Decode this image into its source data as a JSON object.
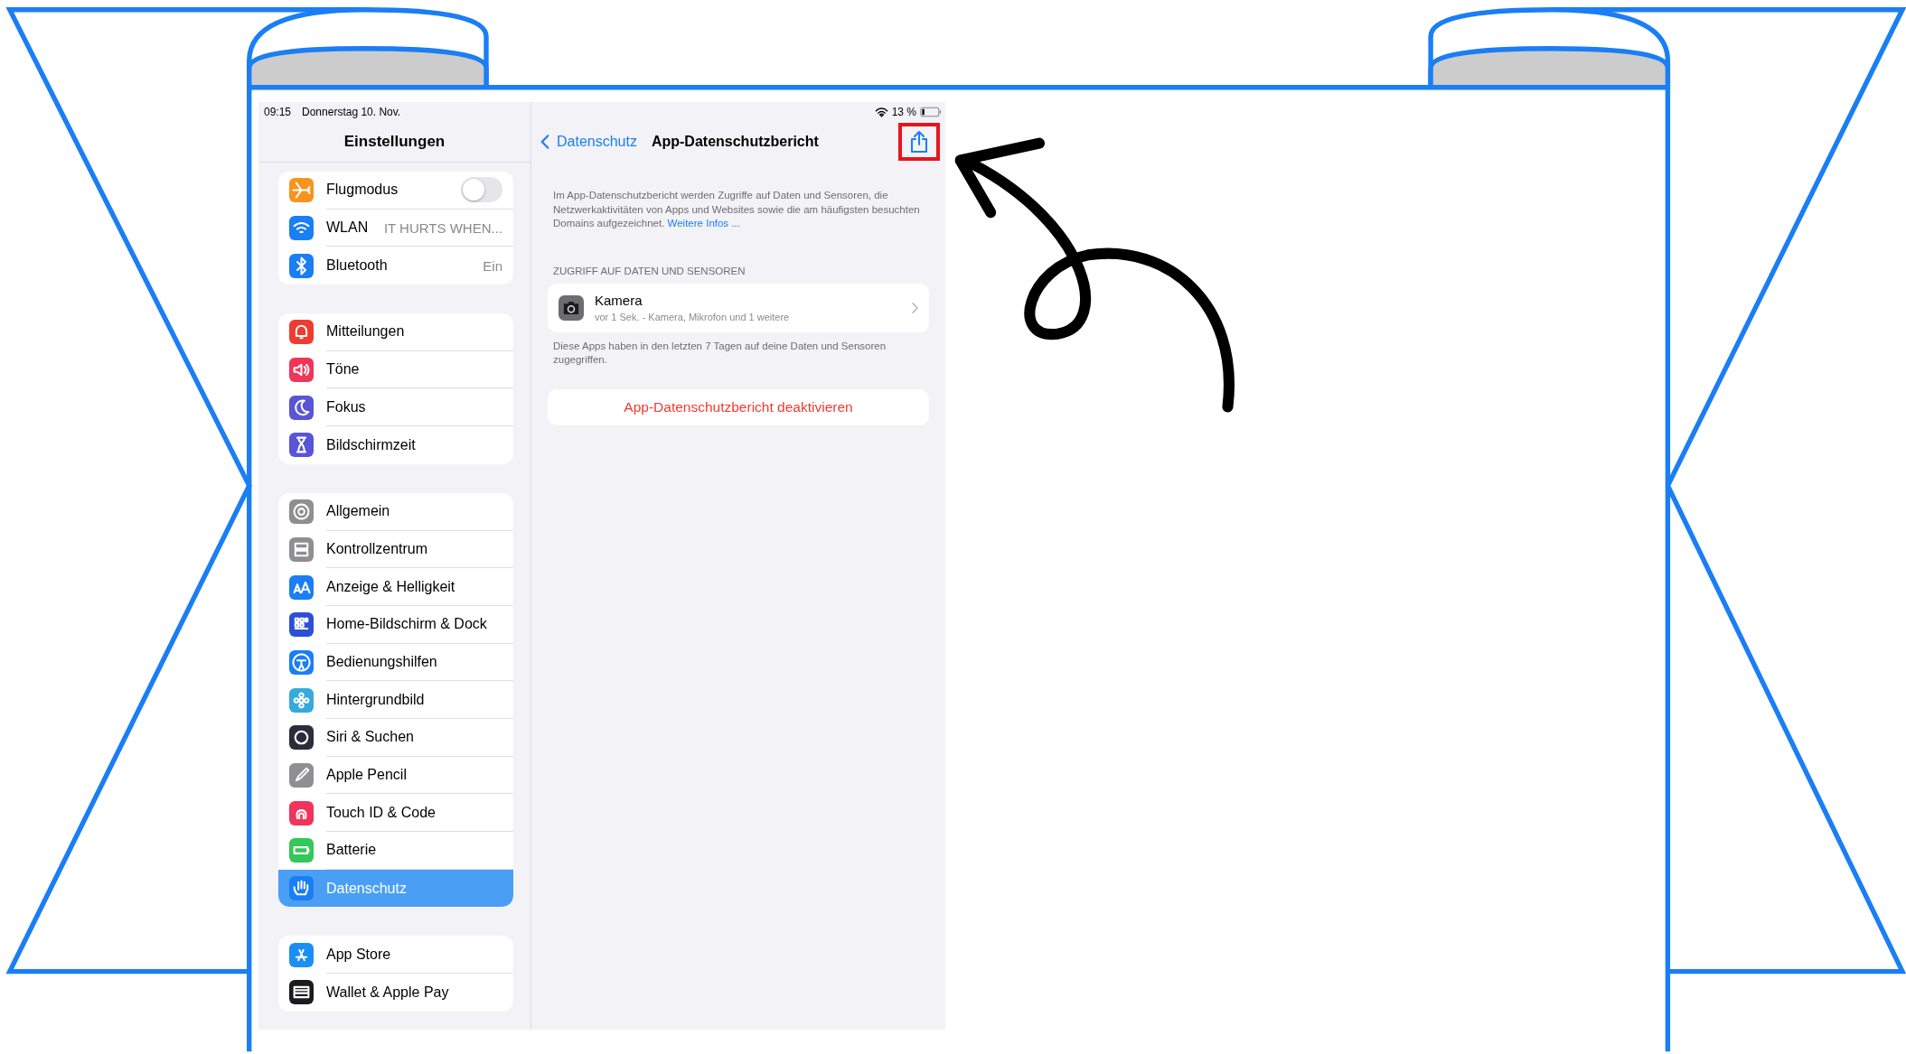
{
  "status_bar": {
    "time": "09:15",
    "date": "Donnerstag 10. Nov.",
    "battery": "13 %"
  },
  "sidebar": {
    "title": "Einstellungen",
    "groups": [
      [
        {
          "label": "Flugmodus",
          "kind": "airplane",
          "color": "#f7931e",
          "selected": false,
          "toggle": {
            "on": false
          }
        },
        {
          "label": "WLAN",
          "kind": "wifi",
          "color": "#1a7ef5",
          "selected": false,
          "value": "IT HURTS WHEN..."
        },
        {
          "label": "Bluetooth",
          "kind": "bluetooth",
          "color": "#1a7ef5",
          "selected": false,
          "value": "Ein"
        }
      ],
      [
        {
          "label": "Mitteilungen",
          "kind": "bell",
          "color": "#f03c30",
          "selected": false
        },
        {
          "label": "Töne",
          "kind": "speaker",
          "color": "#f0345a",
          "selected": false
        },
        {
          "label": "Fokus",
          "kind": "moon",
          "color": "#5a55d6",
          "selected": false
        },
        {
          "label": "Bildschirmzeit",
          "kind": "hourglass",
          "color": "#5a55d6",
          "selected": false
        }
      ],
      [
        {
          "label": "Allgemein",
          "kind": "gear",
          "color": "#8e8e93",
          "selected": false
        },
        {
          "label": "Kontrollzentrum",
          "kind": "switches",
          "color": "#8e8e93",
          "selected": false
        },
        {
          "label": "Anzeige & Helligkeit",
          "kind": "letters",
          "color": "#1a7ef5",
          "selected": false
        },
        {
          "label": "Home-Bildschirm & Dock",
          "kind": "grid",
          "color": "#2d4fd6",
          "selected": false
        },
        {
          "label": "Bedienungshilfen",
          "kind": "person",
          "color": "#1a7ef5",
          "selected": false
        },
        {
          "label": "Hintergrundbild",
          "kind": "flower",
          "color": "#35aadc",
          "selected": false
        },
        {
          "label": "Siri & Suchen",
          "kind": "orb",
          "color": "#2c2c3e",
          "selected": false
        },
        {
          "label": "Apple Pencil",
          "kind": "pencil",
          "color": "#8e8e93",
          "selected": false
        },
        {
          "label": "Touch ID & Code",
          "kind": "fingerprint",
          "color": "#f0345a",
          "selected": false
        },
        {
          "label": "Batterie",
          "kind": "battery",
          "color": "#34c759",
          "selected": false
        },
        {
          "label": "Datenschutz",
          "kind": "hand",
          "color": "#1a7ef5",
          "selected": true
        }
      ],
      [
        {
          "label": "App Store",
          "kind": "appstore",
          "color": "#1a8ef5",
          "selected": false
        },
        {
          "label": "Wallet & Apple Pay",
          "kind": "wallet",
          "color": "#1c1c1e",
          "selected": false
        }
      ]
    ]
  },
  "detail": {
    "back_label": "Datenschutz",
    "title": "App-Datenschutzbericht",
    "share_highlighted": true,
    "intro": "Im App-Datenschutzbericht werden Zugriffe auf Daten und Sensoren, die Netzwerkaktivitäten von Apps und Websites sowie die am häufigsten besuchten Domains aufgezeichnet.",
    "intro_link": "Weitere Infos ...",
    "section_header": "ZUGRIFF AUF DATEN UND SENSOREN",
    "rows": [
      {
        "title": "Kamera",
        "subtitle": "vor 1 Sek. - Kamera, Mikrofon und 1 weitere"
      }
    ],
    "footer": "Diese Apps haben in den letzten 7 Tagen auf deine Daten und Sensoren zugegriffen.",
    "action": "App-Datenschutzbericht deaktivieren"
  }
}
